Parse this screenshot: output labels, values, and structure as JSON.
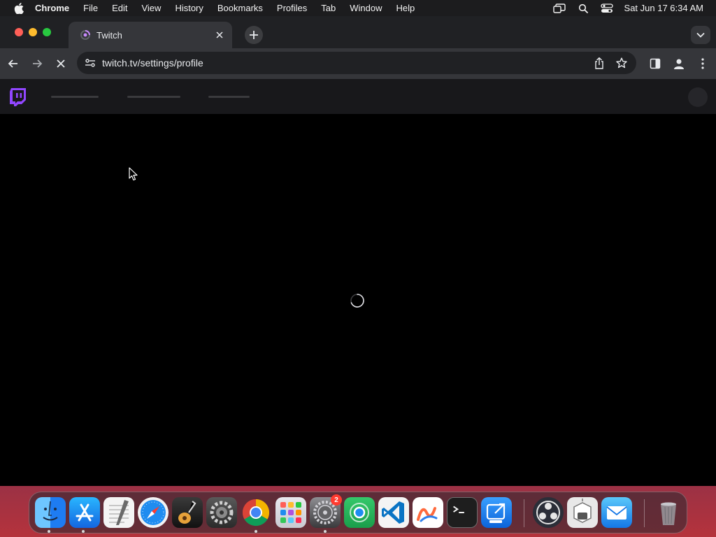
{
  "menubar": {
    "app_name": "Chrome",
    "items": [
      "File",
      "Edit",
      "View",
      "History",
      "Bookmarks",
      "Profiles",
      "Tab",
      "Window",
      "Help"
    ],
    "status_icons": [
      "screen-mirroring-icon",
      "spotlight-search-icon",
      "control-center-icon"
    ],
    "clock": "Sat Jun 17  6:34 AM"
  },
  "browser": {
    "tab": {
      "title": "Twitch",
      "favicon": "loading-favicon-icon"
    },
    "omnibox": {
      "url": "twitch.tv/settings/profile"
    },
    "page_loading": true
  },
  "page": {
    "site": "twitch",
    "brand_color": "#9146ff",
    "state": "loading"
  },
  "dock": {
    "apps": [
      {
        "name": "Finder",
        "icon": "finder-icon",
        "running": true
      },
      {
        "name": "App Store",
        "icon": "app-store-icon",
        "running": true
      },
      {
        "name": "TextEdit",
        "icon": "textedit-icon",
        "running": false
      },
      {
        "name": "Safari",
        "icon": "safari-icon",
        "running": false
      },
      {
        "name": "GarageBand",
        "icon": "garageband-icon",
        "running": false
      },
      {
        "name": "Compressor",
        "icon": "gear-app-icon",
        "running": false
      },
      {
        "name": "Google Chrome",
        "icon": "chrome-icon",
        "running": true
      },
      {
        "name": "Launchpad",
        "icon": "launchpad-icon",
        "running": false
      },
      {
        "name": "System Settings",
        "icon": "system-settings-icon",
        "running": true,
        "badge": "2"
      },
      {
        "name": "Find My",
        "icon": "find-my-icon",
        "running": false
      },
      {
        "name": "Visual Studio Code",
        "icon": "vscode-icon",
        "running": false
      },
      {
        "name": "Freeform",
        "icon": "freeform-icon",
        "running": false
      },
      {
        "name": "Terminal",
        "icon": "terminal-icon",
        "running": false
      },
      {
        "name": "Remote Desktop",
        "icon": "remote-desktop-icon",
        "running": false
      },
      {
        "name": "OBS Studio",
        "icon": "obs-icon",
        "running": false
      },
      {
        "name": "Automator",
        "icon": "automator-icon",
        "running": false
      },
      {
        "name": "Mail",
        "icon": "mail-icon",
        "running": false
      },
      {
        "name": "Trash",
        "icon": "trash-icon",
        "running": false
      }
    ]
  }
}
